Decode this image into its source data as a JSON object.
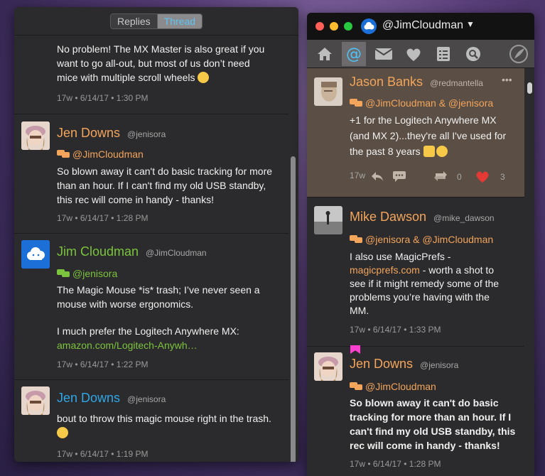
{
  "left_window": {
    "segments": [
      "Replies",
      "Thread"
    ],
    "posts": [
      {
        "text_lines": [
          "No problem! The MX Master is also great if you",
          "want to go all-out, but most of us don’t need",
          "mice with multiple scroll wheels"
        ],
        "meta": "17w • 6/14/17 • 1:30 PM"
      },
      {
        "name": "Jen Downs",
        "handle": "@jenisora",
        "reply_to": "@JimCloudman",
        "text_lines": [
          "So blown away it can't do basic tracking for more",
          "than an hour. If I can't find my old USB standby,",
          "this rec will come in handy - thanks!"
        ],
        "meta": "17w • 6/14/17 • 1:28 PM"
      },
      {
        "name": "Jim Cloudman",
        "handle": "@JimCloudman",
        "reply_to": "@jenisora",
        "text_lines": [
          "The Magic Mouse *is* trash; I’ve never seen a",
          "mouse with worse ergonomics.",
          "",
          "I much prefer the Logitech Anywhere MX:"
        ],
        "link": "amazon.com/Logitech-Anywh…",
        "meta": "17w • 6/14/17 • 1:22 PM"
      },
      {
        "name": "Jen Downs",
        "handle": "@jenisora",
        "text_lines": [
          "bout to throw this magic mouse right in the trash."
        ],
        "meta": "17w • 6/14/17 • 1:19 PM"
      }
    ]
  },
  "right_window": {
    "account": "@JimCloudman",
    "tabs": [
      "home-icon",
      "mentions-icon",
      "messages-icon",
      "favorites-icon",
      "lists-icon",
      "search-icon",
      "compose-icon"
    ],
    "posts": [
      {
        "name": "Jason Banks",
        "handle": "@redmantella",
        "reply_to": "@JimCloudman & @jenisora",
        "text_lines": [
          "+1 for the Logitech Anywhere MX",
          "(and MX 2)...they're all I've used for",
          "the past 8 years"
        ],
        "age": "17w",
        "reposts": "0",
        "likes": "3",
        "more": "•••"
      },
      {
        "name": "Mike Dawson",
        "handle": "@mike_dawson",
        "reply_to": "@jenisora & @JimCloudman",
        "text_lines": [
          "I also use MagicPrefs -"
        ],
        "link": "magicprefs.com",
        "text_after_link": " - worth a shot to",
        "text_lines_2": [
          "see if it might remedy some of the",
          "problems you’re having with the",
          "MM."
        ],
        "meta": "17w • 6/14/17 • 1:33 PM"
      },
      {
        "name": "Jen Downs",
        "handle": "@jenisora",
        "reply_to": "@JimCloudman",
        "text_lines": [
          "So blown away it can't do basic",
          "tracking for more than an hour. If I",
          "can't find my old USB standby, this",
          "rec will come in handy - thanks!"
        ],
        "meta": "17w • 6/14/17 • 1:28 PM"
      }
    ]
  },
  "colors": {
    "orange": "#f3a55b",
    "green": "#7bc43d",
    "blue": "#2fa7e6",
    "highlight": "#5a4e45"
  }
}
